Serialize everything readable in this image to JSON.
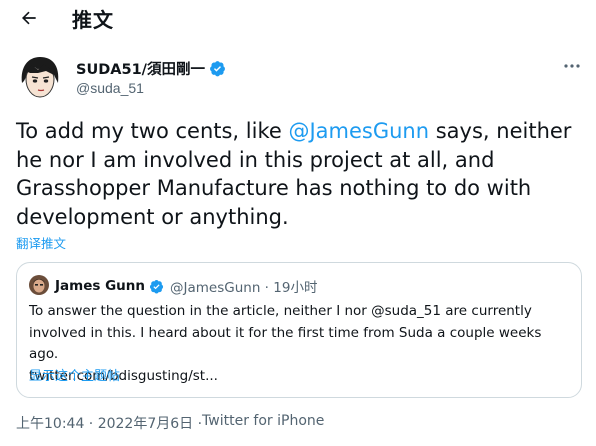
{
  "header": {
    "back_icon": "arrow-left-icon",
    "title": "推文"
  },
  "tweet": {
    "author_name": "SUDA51/須田剛一",
    "verified_icon": "verified-badge-icon",
    "handle": "@suda_51",
    "more_icon": "more-horizontal-icon",
    "text_part1": "To add my two cents, like ",
    "mention": "@JamesGunn",
    "text_part2": " says, neither he nor I am involved in this project at all, and Grasshopper Manufacture has nothing to do with development or anything.",
    "translate_label": "翻译推文",
    "time": "上午10:44 · 2022年7月6日 · ",
    "source": "Twitter for iPhone"
  },
  "quote": {
    "author_name": "James Gunn",
    "handle_time": "@JamesGunn · 19小时",
    "line1": "To answer the question in the article, neither I nor @suda_51 are currently",
    "line2": "involved in this. I heard about it for the first time from Suda a couple weeks ago.",
    "line3": "twitter.com/bdisgusting/st...",
    "show_thread": "显示这个主题帖"
  },
  "colors": {
    "accent": "#1d9bf0",
    "text": "#0f1419",
    "muted": "#536471",
    "border": "#cfd9de"
  }
}
